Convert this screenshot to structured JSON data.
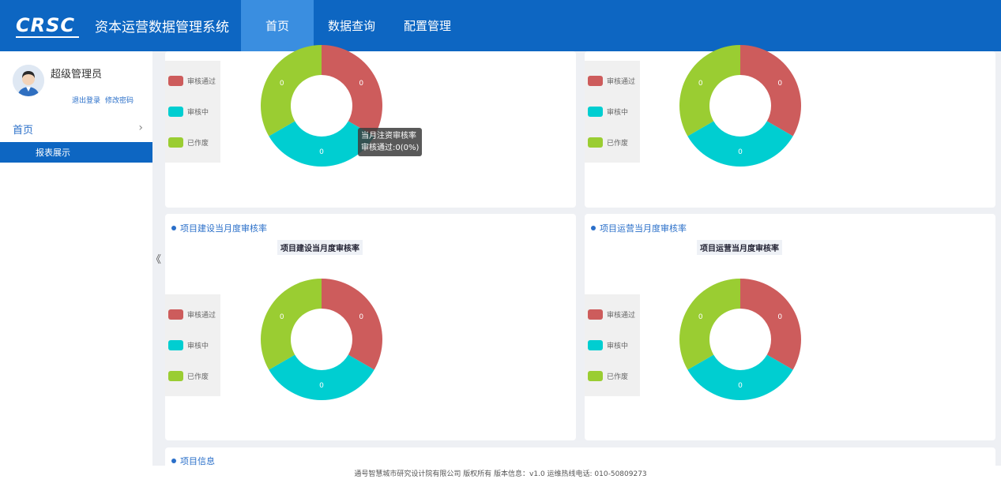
{
  "header": {
    "logo_text": "CRSC",
    "app_title": "资本运营数据管理系统",
    "nav": [
      {
        "label": "首页",
        "active": true
      },
      {
        "label": "数据查询",
        "active": false
      },
      {
        "label": "配置管理",
        "active": false
      }
    ]
  },
  "sidebar": {
    "user_name": "超级管理员",
    "logout": "退出登录",
    "change_password": "修改密码",
    "menu_home": "首页",
    "menu_sub": "报表展示",
    "collapse": "《"
  },
  "legend": {
    "approved": "审核通过",
    "pending": "审核中",
    "voided": "已作废"
  },
  "colors": {
    "approved": "#cd5c5c",
    "pending": "#00ced1",
    "voided": "#9acd32",
    "brand": "#0d66c2"
  },
  "panels": {
    "top_left": {
      "title": "",
      "chart_title": ""
    },
    "top_right": {
      "title": "",
      "chart_title": ""
    },
    "mid_left": {
      "title": "项目建设当月度审核率",
      "chart_title": "项目建设当月度审核率"
    },
    "mid_right": {
      "title": "项目运营当月度审核率",
      "chart_title": "项目运营当月度审核率"
    },
    "bottom": {
      "title": "项目信息"
    }
  },
  "tooltip": {
    "line1": "当月注资审核率",
    "line2": "审核通过:0(0%)"
  },
  "chart_data": [
    {
      "type": "pie",
      "categories": [
        "审核通过",
        "审核中",
        "已作废"
      ],
      "values": [
        0,
        0,
        0
      ]
    },
    {
      "type": "pie",
      "categories": [
        "审核通过",
        "审核中",
        "已作废"
      ],
      "values": [
        0,
        0,
        0
      ]
    },
    {
      "type": "pie",
      "title": "项目建设当月度审核率",
      "categories": [
        "审核通过",
        "审核中",
        "已作废"
      ],
      "values": [
        0,
        0,
        0
      ]
    },
    {
      "type": "pie",
      "title": "项目运营当月度审核率",
      "categories": [
        "审核通过",
        "审核中",
        "已作废"
      ],
      "values": [
        0,
        0,
        0
      ]
    }
  ],
  "footer": "通号智慧城市研究设计院有限公司 版权所有 版本信息：v1.0 运维热线电话: 010-50809273"
}
